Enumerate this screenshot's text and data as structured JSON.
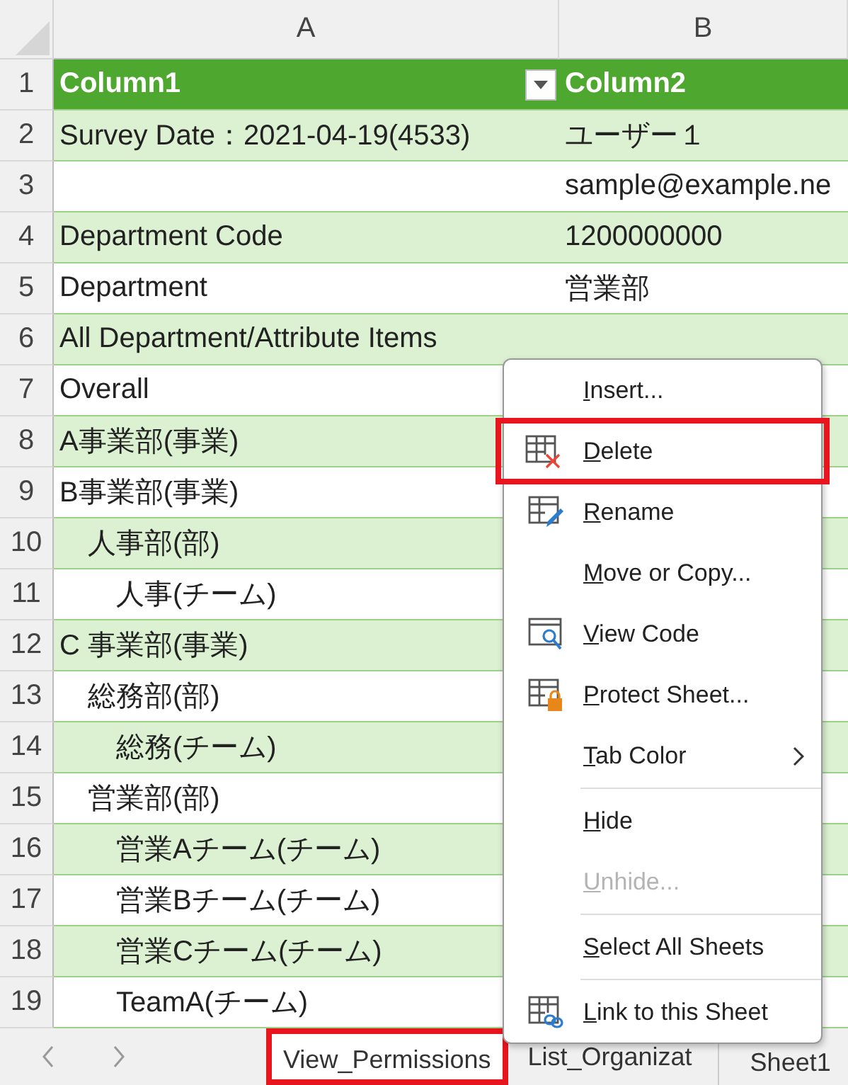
{
  "column_headers": [
    "A",
    "B"
  ],
  "rows": [
    {
      "number": "1",
      "a": "Column1",
      "b": "Column2",
      "kind": "header"
    },
    {
      "number": "2",
      "a": "Survey Date：2021-04-19(4533)",
      "b": "ユーザー１",
      "kind": "data"
    },
    {
      "number": "3",
      "b": "sample@example.ne",
      "kind": "data"
    },
    {
      "number": "4",
      "a": "Department Code",
      "b": "1200000000",
      "kind": "data"
    },
    {
      "number": "5",
      "a": "Department",
      "b": "営業部",
      "kind": "data"
    },
    {
      "number": "6",
      "a": "All Department/Attribute Items",
      "kind": "data"
    },
    {
      "number": "7",
      "a": "Overall",
      "kind": "data"
    },
    {
      "number": "8",
      "a": "A事業部(事業)",
      "kind": "data"
    },
    {
      "number": "9",
      "a": "B事業部(事業)",
      "kind": "data"
    },
    {
      "number": "10",
      "a": "　人事部(部)",
      "kind": "data"
    },
    {
      "number": "11",
      "a": "　　人事(チーム)",
      "kind": "data"
    },
    {
      "number": "12",
      "a": "C 事業部(事業)",
      "kind": "data"
    },
    {
      "number": "13",
      "a": "　総務部(部)",
      "kind": "data"
    },
    {
      "number": "14",
      "a": "　　総務(チーム)",
      "kind": "data"
    },
    {
      "number": "15",
      "a": "　営業部(部)",
      "kind": "data"
    },
    {
      "number": "16",
      "a": "　　営業Aチーム(チーム)",
      "kind": "data"
    },
    {
      "number": "17",
      "a": "　　営業Bチーム(チーム)",
      "kind": "data"
    },
    {
      "number": "18",
      "a": "　　営業Cチーム(チーム)",
      "kind": "data"
    },
    {
      "number": "19",
      "a": "　　TeamA(チーム)",
      "kind": "data"
    }
  ],
  "context_menu": [
    {
      "label": "Insert...",
      "kind": "plain",
      "disabled": false,
      "annotated": false
    },
    {
      "label": "Delete",
      "kind": "delete",
      "disabled": false,
      "annotated": true
    },
    {
      "label": "Rename",
      "kind": "rename",
      "disabled": false,
      "annotated": false
    },
    {
      "label": "Move or Copy...",
      "kind": "plain",
      "disabled": false,
      "annotated": false
    },
    {
      "label": "View Code",
      "kind": "code",
      "disabled": false,
      "annotated": false
    },
    {
      "label": "Protect Sheet...",
      "kind": "protect",
      "disabled": false,
      "annotated": false
    },
    {
      "label": "Tab Color",
      "kind": "submenu",
      "disabled": false,
      "annotated": false
    },
    {
      "kind": "separator"
    },
    {
      "label": "Hide",
      "kind": "plain",
      "disabled": false,
      "annotated": false
    },
    {
      "label": "Unhide...",
      "kind": "plain",
      "disabled": true,
      "annotated": false
    },
    {
      "kind": "separator"
    },
    {
      "label": "Select All Sheets",
      "kind": "plain",
      "disabled": false,
      "annotated": false
    },
    {
      "kind": "separator"
    },
    {
      "label": "Link to this Sheet",
      "kind": "link",
      "disabled": false,
      "annotated": false
    }
  ],
  "sheet_tabs": [
    {
      "label": "View_Permissions",
      "selected": true,
      "annotated": true
    },
    {
      "label": "List_Organizat",
      "selected": false,
      "annotated": false
    },
    {
      "label": "Sheet1",
      "selected": false,
      "annotated": false
    }
  ]
}
